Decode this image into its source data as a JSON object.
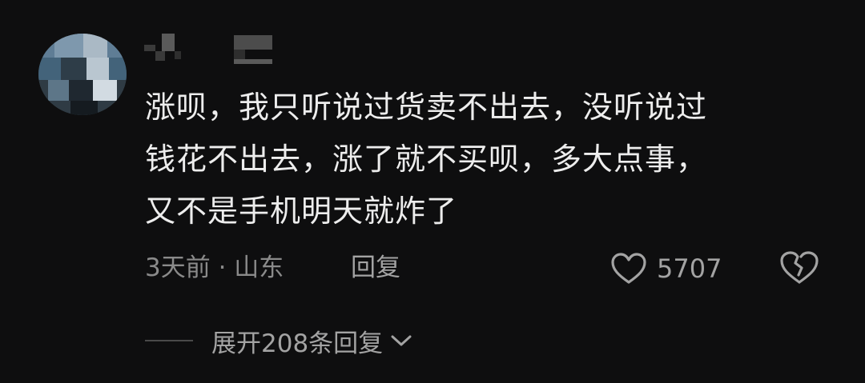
{
  "comment": {
    "lines": [
      "涨呗，我只听说过货卖不出去，没听说过",
      "钱花不出去，涨了就不买呗，多大点事，",
      "又不是手机明天就炸了"
    ],
    "time_location": "3天前 · 山东",
    "reply_label": "回复",
    "like_count": "5707"
  },
  "replies": {
    "expand_label": "展开208条回复"
  },
  "icons": {
    "like": "heart-outline-icon",
    "dislike": "broken-heart-icon",
    "expand": "chevron-down-icon"
  },
  "colors": {
    "background": "#0e0e0f",
    "text": "#ededed",
    "muted": "#8a8a8a",
    "action": "#a3a3a3"
  }
}
